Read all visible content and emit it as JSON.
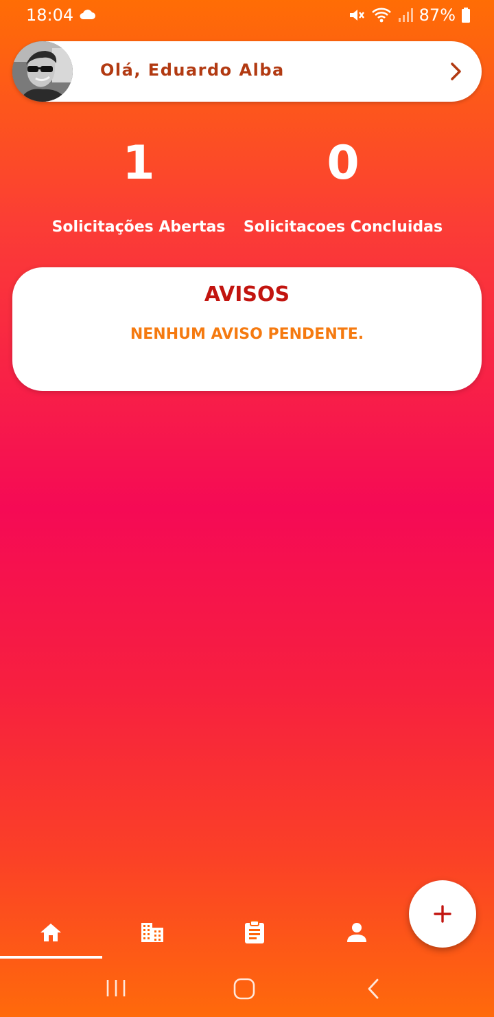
{
  "status_bar": {
    "time": "18:04",
    "battery": "87%",
    "icons": [
      "cloud-icon",
      "mute-icon",
      "wifi-icon",
      "signal-icon",
      "battery-icon"
    ]
  },
  "header": {
    "greeting": "Olá, Eduardo Alba",
    "avatar": "avatar",
    "action_icon": "chevron-right-icon"
  },
  "stats": [
    {
      "count": "1",
      "label": "Solicitações Abertas"
    },
    {
      "count": "0",
      "label": "Solicitacoes Concluidas"
    }
  ],
  "avisos": {
    "title": "AVISOS",
    "empty_message": "NENHUM AVISO PENDENTE."
  },
  "fab": {
    "icon": "plus-icon",
    "color": "#c2140f"
  },
  "bottom_nav": {
    "items": [
      {
        "icon": "home-icon",
        "active": true
      },
      {
        "icon": "building-icon",
        "active": false
      },
      {
        "icon": "clipboard-icon",
        "active": false
      },
      {
        "icon": "person-icon",
        "active": false
      }
    ]
  },
  "system_nav": {
    "icons": [
      "recents-icon",
      "home-circle-icon",
      "back-icon"
    ]
  },
  "colors": {
    "gradient_top": "#ff6d05",
    "gradient_middle": "#f50a55",
    "gradient_bottom": "#ff6a0b",
    "greeting_text": "#b23a12",
    "avisos_title": "#c2140f",
    "avisos_message": "#f57a10"
  }
}
